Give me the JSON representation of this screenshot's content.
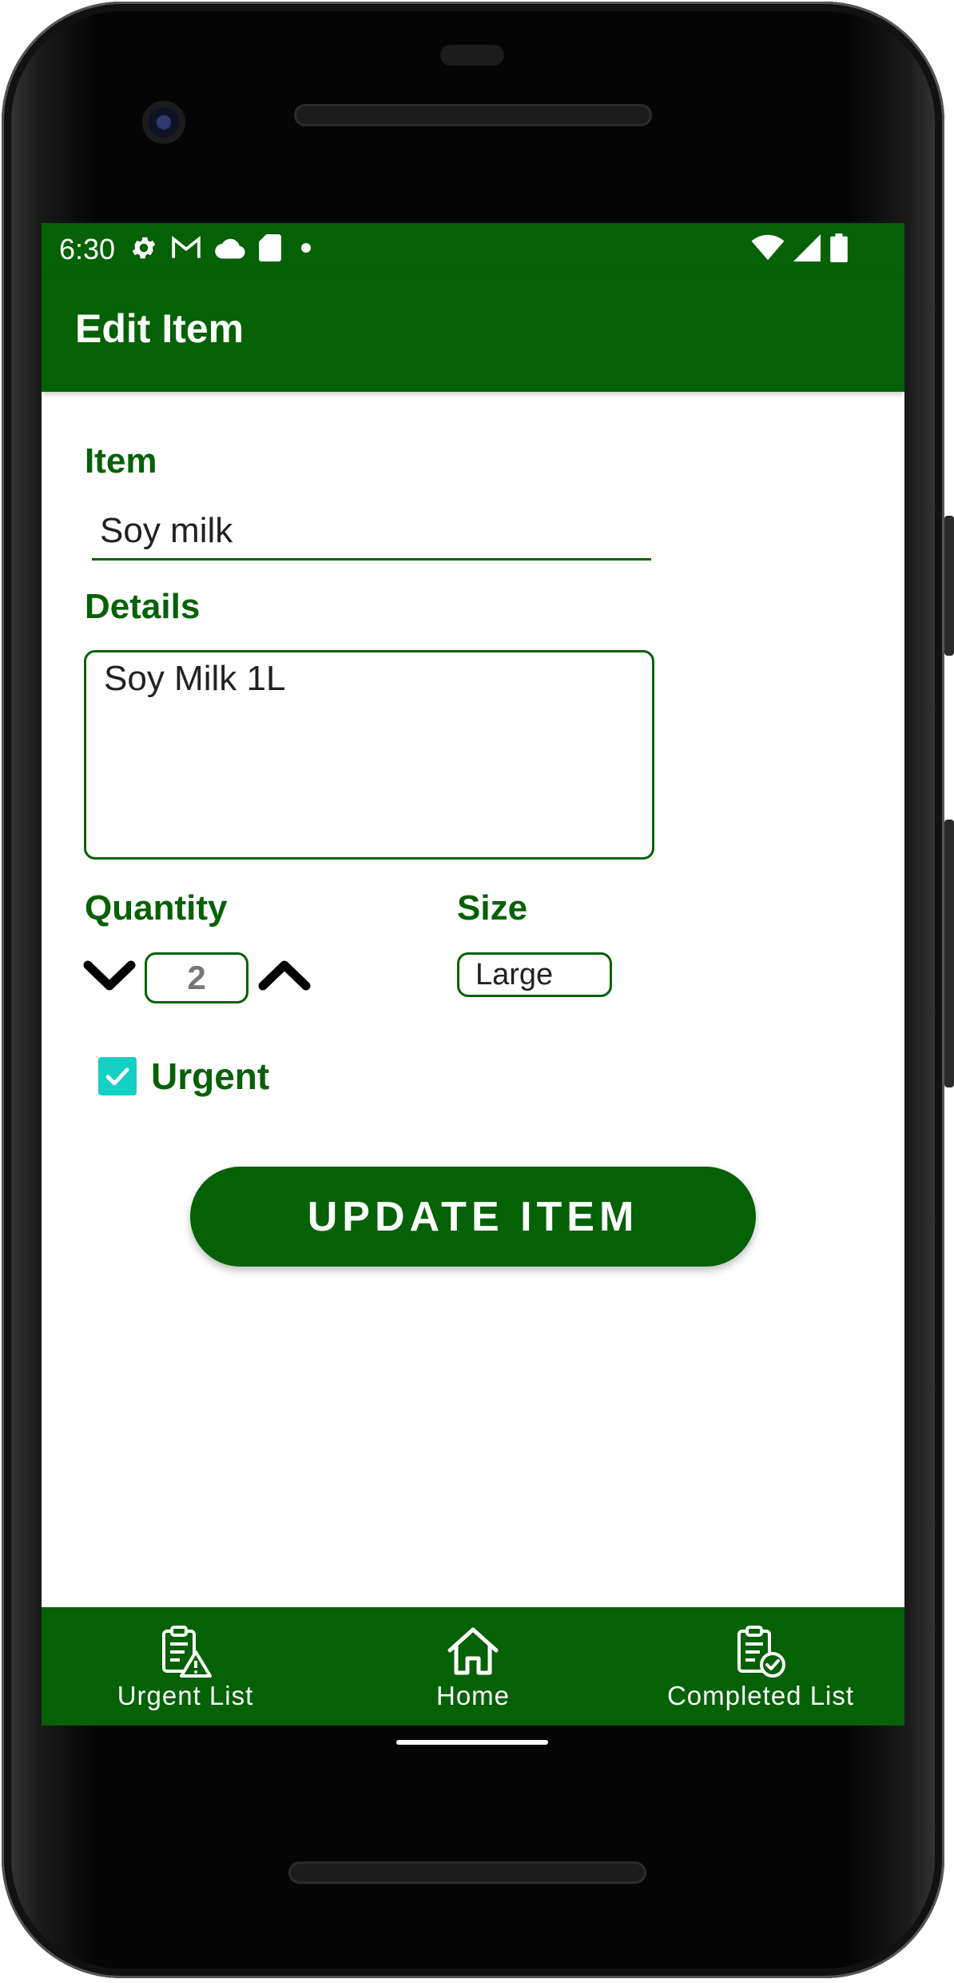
{
  "status_bar": {
    "time": "6:30",
    "left_icons": [
      "gear-icon",
      "gmail-icon",
      "cloud-icon",
      "sd-card-icon",
      "dot-icon"
    ],
    "right_icons": [
      "wifi-icon",
      "signal-icon",
      "battery-icon"
    ]
  },
  "app_bar": {
    "title": "Edit Item"
  },
  "form": {
    "item_label": "Item",
    "item_value": "Soy milk",
    "details_label": "Details",
    "details_value": "Soy Milk 1L",
    "quantity_label": "Quantity",
    "quantity_value": "2",
    "size_label": "Size",
    "size_value": "Large",
    "urgent_label": "Urgent",
    "urgent_checked": true,
    "update_button": "UPDATE ITEM"
  },
  "bottom_nav": {
    "items": [
      {
        "label": "Urgent List",
        "icon": "clipboard-warning-icon"
      },
      {
        "label": "Home",
        "icon": "home-icon"
      },
      {
        "label": "Completed List",
        "icon": "clipboard-check-icon"
      }
    ]
  },
  "colors": {
    "primary": "#056105",
    "checkbox": "#14d0c4",
    "surface": "#ffffff"
  }
}
